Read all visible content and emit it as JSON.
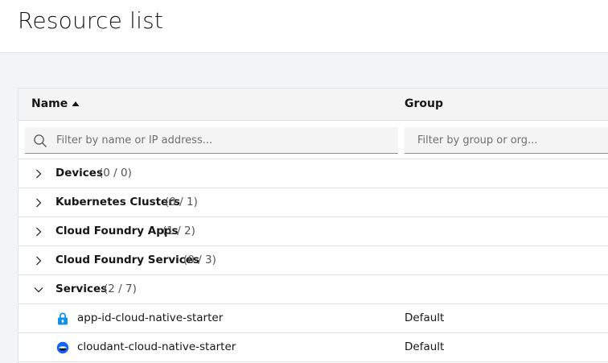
{
  "page": {
    "title": "Resource list"
  },
  "table": {
    "columns": {
      "name": "Name",
      "group": "Group"
    },
    "sort": {
      "column": "Name",
      "direction": "ascending",
      "icon": "caret-up-icon"
    },
    "filters": {
      "name_placeholder": "Filter by name or IP address...",
      "group_placeholder": "Filter by group or org...",
      "name_value": "",
      "group_value": ""
    },
    "groups": [
      {
        "label": "Devices",
        "count": "(0 / 0)",
        "expanded": false
      },
      {
        "label": "Kubernetes Clusters",
        "count": "(0 / 1)",
        "expanded": false
      },
      {
        "label": "Cloud Foundry Apps",
        "count": "(1 / 2)",
        "expanded": false
      },
      {
        "label": "Cloud Foundry Services",
        "count": "(0 / 3)",
        "expanded": false
      },
      {
        "label": "Services",
        "count": "(2 / 7)",
        "expanded": true
      }
    ],
    "services": [
      {
        "name": "app-id-cloud-native-starter",
        "group": "Default",
        "icon": "app-id-service-icon"
      },
      {
        "name": "cloudant-cloud-native-starter",
        "group": "Default",
        "icon": "cloudant-service-icon"
      }
    ]
  },
  "colors": {
    "header_bg": "#f4f4f4",
    "app_id_blue": "#1192e8",
    "cloudant_blue": "#0f62fe",
    "border": "#e0e0e0"
  }
}
